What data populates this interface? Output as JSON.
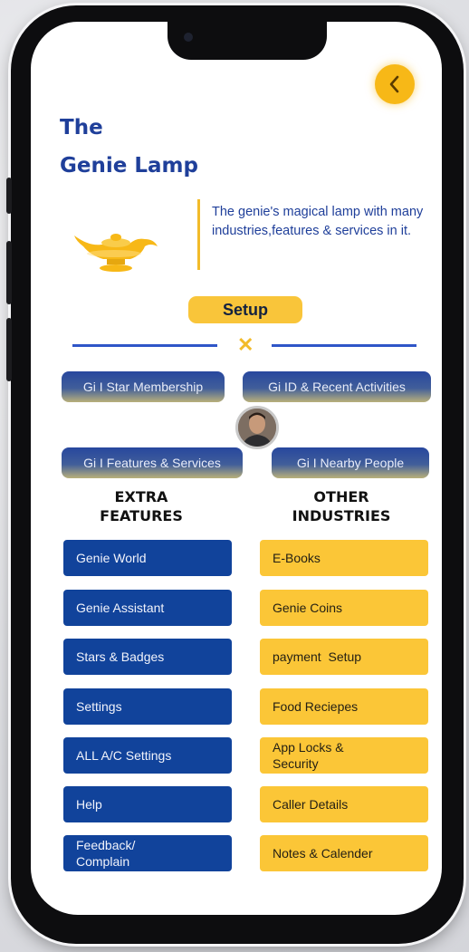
{
  "header": {
    "title_line1": "The",
    "title_line2": "Genie Lamp",
    "description": "The genie's magical lamp with many industries,features & services in it.",
    "back_icon": "chevron-left-icon",
    "lamp_icon": "magic-lamp-icon"
  },
  "setup_label": "Setup",
  "divider_icon": "x-icon",
  "pills": {
    "star_membership": "Gi I Star Membership",
    "id_recent": "Gi ID & Recent Activities",
    "features_services": "Gi I Features & Services",
    "nearby_people": "Gi I Nearby People"
  },
  "sections": {
    "extra_features": "EXTRA\nFEATURES",
    "other_industries": "OTHER\nINDUSTRIES"
  },
  "extra_features": [
    "Genie World",
    "Genie Assistant",
    "Stars & Badges",
    "Settings",
    "ALL A/C Settings",
    "Help",
    "Feedback/\nComplain"
  ],
  "other_industries": [
    "E-Books",
    "Genie Coins",
    "payment  Setup",
    "Food Reciepes",
    "App Locks &\nSecurity",
    "Caller Details",
    "Notes & Calender"
  ],
  "colors": {
    "brand_blue": "#11439b",
    "accent_yellow": "#fbc637",
    "title_blue": "#1f3f9a"
  }
}
